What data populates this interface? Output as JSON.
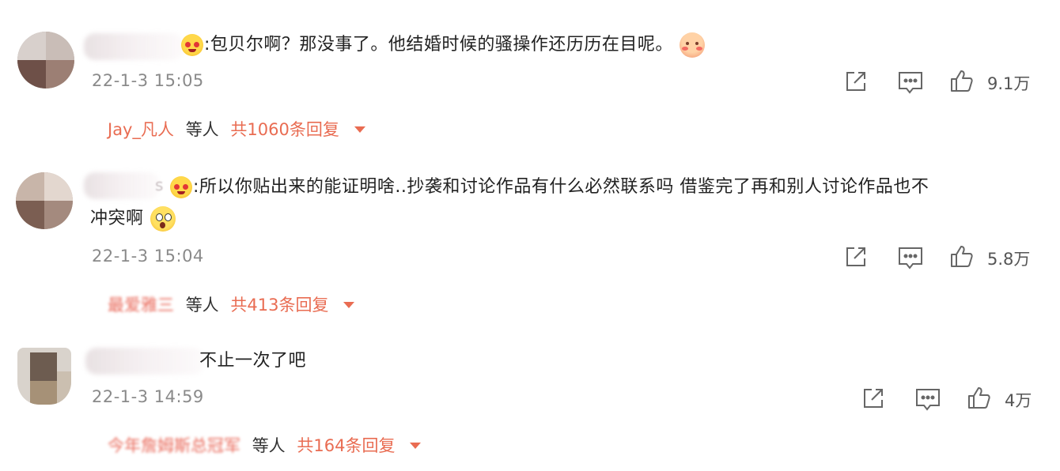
{
  "comments": [
    {
      "text": ":包贝尔啊？那没事了。他结婚时候的骚操作还历历在目呢。",
      "timestamp": "22-1-3 15:05",
      "likes": "9.1万",
      "reply": {
        "name": "Jay_凡人",
        "suffix": "等人",
        "total": "共1060条回复"
      }
    },
    {
      "text_line1": ":所以你贴出来的能证明啥..抄袭和讨论作品有什么必然联系吗 借鉴完了再和别人讨论作品也不",
      "text_line2": "冲突啊",
      "name_fragment": "s",
      "timestamp": "22-1-3 15:04",
      "likes": "5.8万",
      "reply": {
        "name": "最爱雅三",
        "suffix": "等人",
        "total": "共413条回复"
      }
    },
    {
      "text": "不止一次了吧",
      "timestamp": "22-1-3 14:59",
      "likes": "4万",
      "reply": {
        "name": "今年詹姆斯总冠军",
        "suffix": "等人",
        "total": "共164条回复"
      }
    }
  ],
  "icons": {
    "share": "share-icon",
    "comment": "comment-icon",
    "like": "thumbs-up-icon",
    "expand": "caret-down-icon"
  },
  "colors": {
    "accent": "#e96c52",
    "timestamp": "#8a8a8a",
    "text": "#222222"
  }
}
